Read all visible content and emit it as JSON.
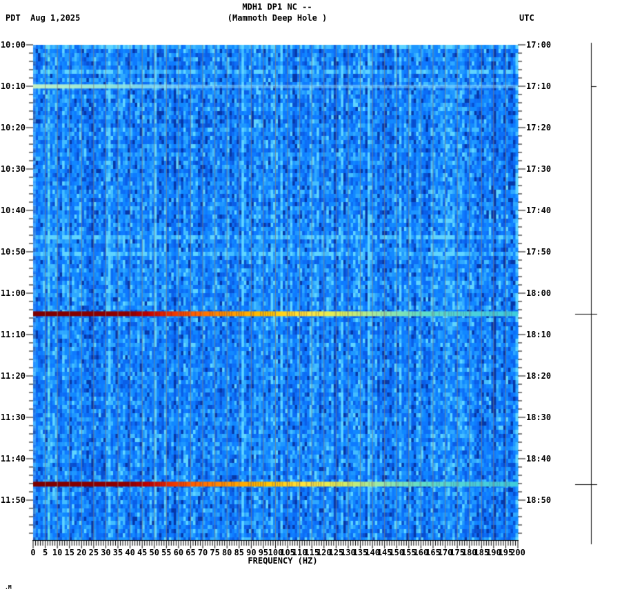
{
  "header": {
    "timezone_left": "PDT",
    "date": "Aug 1,2025",
    "left_text": "PDT  Aug 1,2025",
    "title_line1": "MDH1 DP1 NC --",
    "title_line2": "(Mammoth Deep Hole )",
    "timezone_right": "UTC"
  },
  "x_axis": {
    "title": "FREQUENCY (HZ)",
    "labels": [
      "0",
      "5",
      "10",
      "15",
      "20",
      "25",
      "30",
      "35",
      "40",
      "45",
      "50",
      "55",
      "60",
      "65",
      "70",
      "75",
      "80",
      "85",
      "90",
      "95",
      "100",
      "105",
      "110",
      "115",
      "120",
      "125",
      "130",
      "135",
      "140",
      "145",
      "150",
      "155",
      "160",
      "165",
      "170",
      "175",
      "180",
      "185",
      "190",
      "195",
      "200"
    ]
  },
  "y_axis_left": {
    "labels": [
      "10:00",
      "10:10",
      "10:20",
      "10:30",
      "10:40",
      "10:50",
      "11:00",
      "11:10",
      "11:20",
      "11:30",
      "11:40",
      "11:50"
    ]
  },
  "y_axis_right": {
    "labels": [
      "17:00",
      "17:10",
      "17:20",
      "17:30",
      "17:40",
      "17:50",
      "18:00",
      "18:10",
      "18:20",
      "18:30",
      "18:40",
      "18:50"
    ]
  },
  "watermark": ".M",
  "chart_data": {
    "type": "heatmap",
    "subtype": "seismic-spectrogram",
    "title": "MDH1 DP1 NC -- (Mammoth Deep Hole )",
    "xlabel": "FREQUENCY (HZ)",
    "x_range_hz": [
      0,
      200
    ],
    "x_tick_step_hz": 5,
    "x_minor_tick_hz": 1,
    "time_axis": {
      "date": "Aug 1,2025",
      "start_pdt": "10:00",
      "end_pdt": "12:00",
      "start_utc": "17:00",
      "end_utc": "19:00",
      "major_tick_minutes": 10,
      "minor_tick_minutes": 2
    },
    "background": {
      "palette": [
        "#0638a8",
        "#084fd0",
        "#0a5fe8",
        "#0c6ef6",
        "#0e7bff",
        "#1188ff",
        "#1e97ff",
        "#2ea8ff",
        "#43bdff",
        "#5fd4ff"
      ],
      "grid_color": "#808080",
      "grid_step_hz": 5
    },
    "persistent_tone": {
      "freq_hz": 6,
      "color": "#78f0d7"
    },
    "strong_event_gradient": [
      [
        0.0,
        "#7c0000"
      ],
      [
        0.2,
        "#920000"
      ],
      [
        0.235,
        "#c00000"
      ],
      [
        0.27,
        "#e42500"
      ],
      [
        0.33,
        "#ff5f00"
      ],
      [
        0.4,
        "#ff9500"
      ],
      [
        0.48,
        "#ffc400"
      ],
      [
        0.56,
        "#ffe53e"
      ],
      [
        0.63,
        "#dcee5a"
      ],
      [
        0.71,
        "#9fe9a4"
      ],
      [
        0.8,
        "#63ddc6"
      ],
      [
        0.92,
        "#49cfdc"
      ],
      [
        1.0,
        "#3ecddd"
      ]
    ],
    "events": [
      {
        "time_pdt": "10:11",
        "time_utc": "17:11",
        "row_frac": 0.084,
        "kind": "weak",
        "marker": "small",
        "note": "faint pale cyan-green band, strongest below ~55 Hz"
      },
      {
        "time_pdt": "11:05",
        "time_utc": "18:05",
        "row_frac": 0.543,
        "kind": "strong",
        "marker": "cross",
        "note": "broadband event: dark red at low freq grading to cyan at 200 Hz"
      },
      {
        "time_pdt": "11:46",
        "time_utc": "18:46",
        "row_frac": 0.887,
        "kind": "strong",
        "marker": "cross",
        "note": "broadband event: dark red at low freq grading to cyan at 200 Hz"
      }
    ],
    "marker_bar": {
      "side": "right",
      "tick_styles": [
        "small",
        "cross"
      ]
    }
  }
}
